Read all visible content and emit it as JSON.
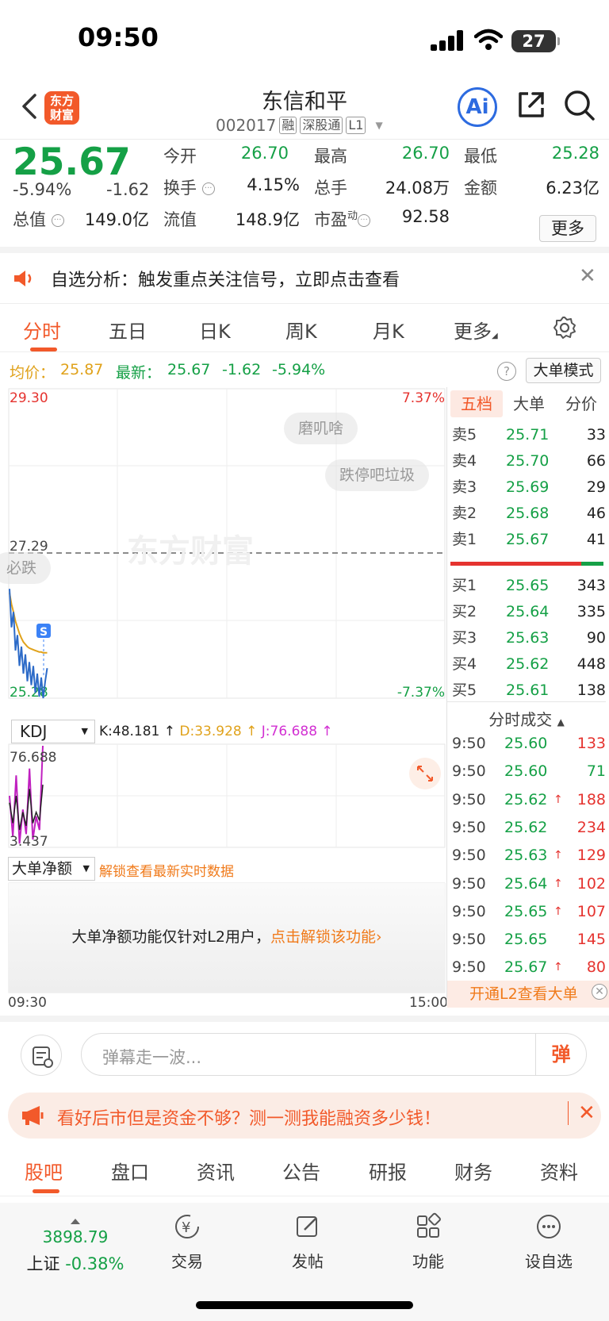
{
  "status_bar": {
    "time": "09:50",
    "battery": "27"
  },
  "header": {
    "logo_line1": "东方",
    "logo_line2": "财富",
    "stock_name": "东信和平",
    "stock_code": "002017",
    "tags": [
      "融",
      "深股通",
      "L1"
    ],
    "ai_label": "Ai"
  },
  "quote": {
    "price": "25.67",
    "change_pct": "-5.94%",
    "change": "-1.62",
    "stats": [
      {
        "label": "今开",
        "value": "26.70",
        "color": "#15a046"
      },
      {
        "label": "最高",
        "value": "26.70",
        "color": "#15a046"
      },
      {
        "label": "最低",
        "value": "25.28",
        "color": "#15a046"
      },
      {
        "label": "换手",
        "value": "4.15%",
        "color": "#222222"
      },
      {
        "label": "总手",
        "value": "24.08万",
        "color": "#222222"
      },
      {
        "label": "金额",
        "value": "6.23亿",
        "color": "#222222"
      },
      {
        "label": "总值",
        "value": "149.0亿",
        "color": "#222222"
      },
      {
        "label": "流值",
        "value": "148.9亿",
        "color": "#222222"
      },
      {
        "label": "市盈",
        "label_sup": "动",
        "value": "92.58",
        "color": "#222222"
      }
    ],
    "more_label": "更多"
  },
  "notice": {
    "text": "自选分析：触发重点关注信号，立即点击查看"
  },
  "chart_tabs": [
    "分时",
    "五日",
    "日K",
    "周K",
    "月K",
    "更多"
  ],
  "avg_row": {
    "avg_label": "均价：",
    "avg_value": "25.87",
    "latest_label": "最新：",
    "latest_value": "25.67",
    "change": "-1.62",
    "change_pct": "-5.94%",
    "bigmode_label": "大单模式"
  },
  "chart_data": {
    "type": "line",
    "title": "",
    "y_range": [
      25.28,
      29.3
    ],
    "y_ticks": [
      "29.30",
      "27.29",
      "25.28"
    ],
    "pct_ticks": [
      "7.37%",
      "-7.37%"
    ],
    "prev_close": 27.29,
    "series": [
      {
        "name": "价格",
        "color": "#2d6bc8",
        "values": [
          26.7,
          26.2,
          26.4,
          25.9,
          26.1,
          25.7,
          25.95,
          25.6,
          25.85,
          25.5,
          25.75,
          25.45,
          25.7,
          25.35,
          25.6,
          25.3,
          25.55,
          25.28,
          25.5,
          25.67
        ]
      },
      {
        "name": "均价",
        "color": "#e0a21b",
        "values": [
          26.65,
          26.5,
          26.4,
          26.28,
          26.2,
          26.12,
          26.06,
          26.01,
          25.98,
          25.95,
          25.93,
          25.92,
          25.91,
          25.9,
          25.89,
          25.88,
          25.88,
          25.87,
          25.87,
          25.87
        ]
      }
    ],
    "kdj": {
      "label": "KDJ",
      "k": "K:48.181",
      "d": "D:33.928",
      "j": "J:76.688",
      "y_ticks": [
        "76.688",
        "3.437"
      ],
      "j_values": [
        40,
        10,
        55,
        5,
        30,
        12,
        60,
        8,
        25,
        15,
        76.688
      ],
      "k_values": [
        35,
        20,
        40,
        15,
        28,
        18,
        45,
        20,
        28,
        22,
        48.181
      ]
    },
    "time_start": "09:30",
    "time_end": "15:00",
    "watermark": "东方财富",
    "danmaku": [
      "磨叽啥",
      "跌停吧垃圾",
      "必跌"
    ]
  },
  "netflow": {
    "select_label": "大单净额",
    "unlock_text": "解锁查看最新实时数据",
    "box_text": "大单净额功能仅针对L2用户，",
    "box_link": "点击解锁该功能"
  },
  "order_book": {
    "tabs": [
      "五档",
      "大单",
      "分价"
    ],
    "asks": [
      {
        "label": "卖5",
        "price": "25.71",
        "vol": "33"
      },
      {
        "label": "卖4",
        "price": "25.70",
        "vol": "66"
      },
      {
        "label": "卖3",
        "price": "25.69",
        "vol": "29"
      },
      {
        "label": "卖2",
        "price": "25.68",
        "vol": "46"
      },
      {
        "label": "卖1",
        "price": "25.67",
        "vol": "41"
      }
    ],
    "bids": [
      {
        "label": "买1",
        "price": "25.65",
        "vol": "343"
      },
      {
        "label": "买2",
        "price": "25.64",
        "vol": "335"
      },
      {
        "label": "买3",
        "price": "25.63",
        "vol": "90"
      },
      {
        "label": "买4",
        "price": "25.62",
        "vol": "448"
      },
      {
        "label": "买5",
        "price": "25.61",
        "vol": "138"
      }
    ],
    "trades_title": "分时成交",
    "trades": [
      {
        "time": "9:50",
        "price": "25.60",
        "arrow": "",
        "vol": "133",
        "color": "#e5332f"
      },
      {
        "time": "9:50",
        "price": "25.60",
        "arrow": "",
        "vol": "71",
        "color": "#15a046"
      },
      {
        "time": "9:50",
        "price": "25.62",
        "arrow": "↑",
        "vol": "188",
        "color": "#e5332f"
      },
      {
        "time": "9:50",
        "price": "25.62",
        "arrow": "",
        "vol": "234",
        "color": "#e5332f"
      },
      {
        "time": "9:50",
        "price": "25.63",
        "arrow": "↑",
        "vol": "129",
        "color": "#e5332f"
      },
      {
        "time": "9:50",
        "price": "25.64",
        "arrow": "↑",
        "vol": "102",
        "color": "#e5332f"
      },
      {
        "time": "9:50",
        "price": "25.65",
        "arrow": "↑",
        "vol": "107",
        "color": "#e5332f"
      },
      {
        "time": "9:50",
        "price": "25.65",
        "arrow": "",
        "vol": "145",
        "color": "#e5332f"
      },
      {
        "time": "9:50",
        "price": "25.67",
        "arrow": "↑",
        "vol": "80",
        "color": "#e5332f"
      }
    ],
    "l2_promo": "开通L2查看大单"
  },
  "danmu_input": {
    "placeholder": "弹幕走一波...",
    "send_label": "弹"
  },
  "promo": {
    "text": "看好后市但是资金不够？测一测我能融资多少钱！"
  },
  "bottom_tabs": [
    "股吧",
    "盘口",
    "资讯",
    "公告",
    "研报",
    "财务",
    "资料"
  ],
  "navbar": {
    "index_value": "3898.79",
    "index_label": "上证",
    "index_change": "-0.38%",
    "items": [
      {
        "label": "交易",
        "icon": "trade-icon"
      },
      {
        "label": "发帖",
        "icon": "post-icon"
      },
      {
        "label": "功能",
        "icon": "grid-icon"
      },
      {
        "label": "设自选",
        "icon": "more-dots-icon"
      }
    ]
  }
}
